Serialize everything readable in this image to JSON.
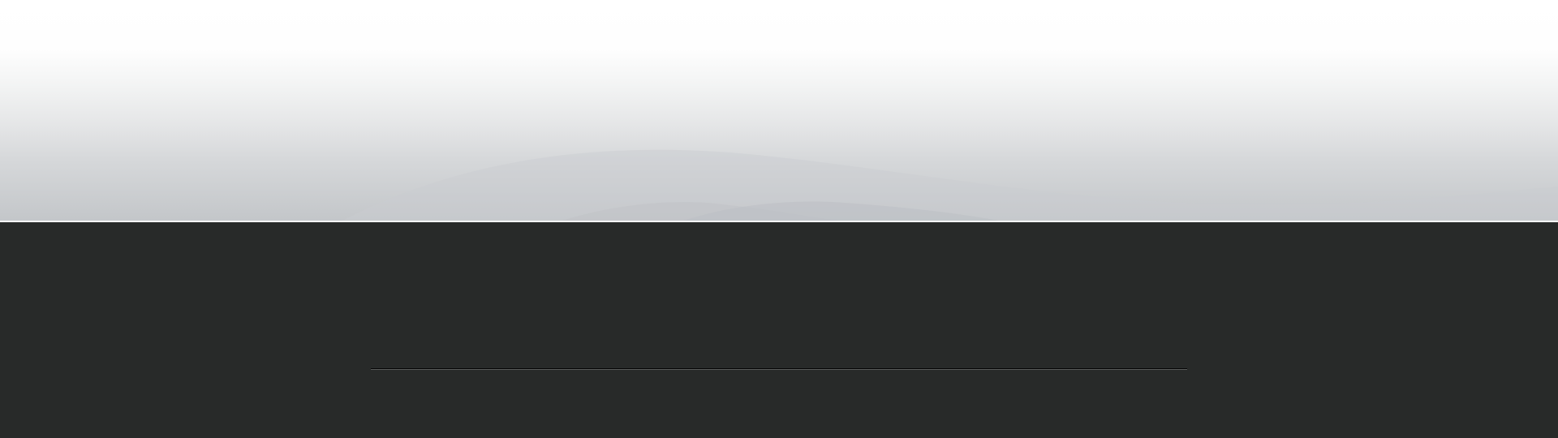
{
  "theme": {
    "hero_top_color": "#ffffff",
    "hero_bottom_color": "#c3c6c9",
    "body_color": "#282a29",
    "divider_color": "#050505"
  }
}
